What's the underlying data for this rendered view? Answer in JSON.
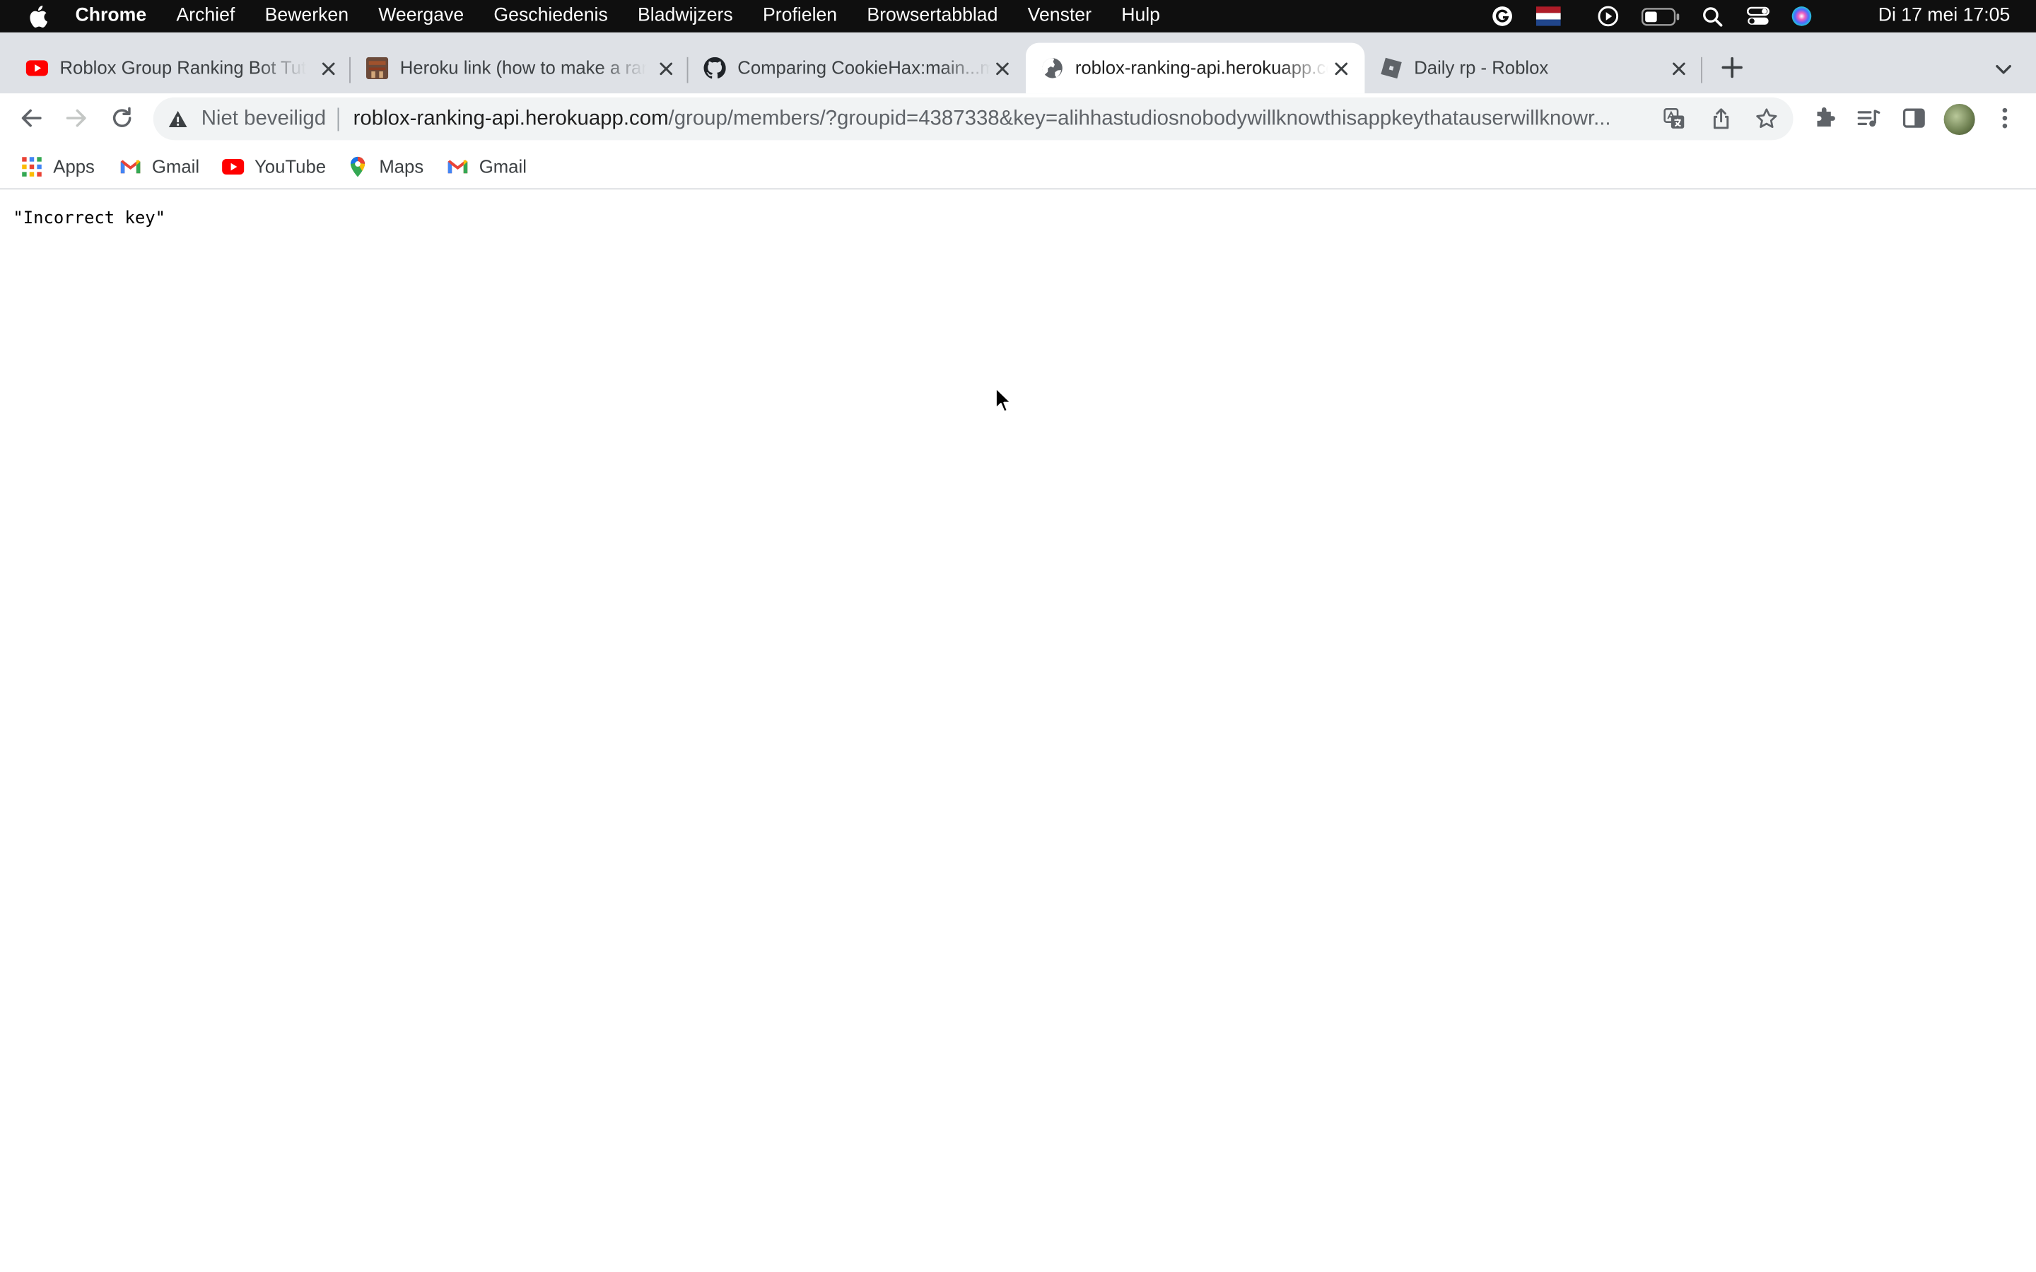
{
  "menubar": {
    "app_name": "Chrome",
    "items": [
      "Archief",
      "Bewerken",
      "Weergave",
      "Geschiedenis",
      "Bladwijzers",
      "Profielen",
      "Browsertabblad",
      "Venster",
      "Hulp"
    ],
    "clock": "Di 17 mei  17:05",
    "status_icons": [
      "grammarly-icon",
      "dutch-flag-icon",
      "play-circle-icon",
      "battery-icon",
      "spotlight-search-icon",
      "control-center-icon",
      "siri-icon"
    ]
  },
  "tabs": [
    {
      "title": "Roblox Group Ranking Bot Tutorial",
      "icon": "youtube-icon",
      "active": false
    },
    {
      "title": "Heroku link (how to make a ranking bot)",
      "icon": "image-thumbnail-icon",
      "active": false
    },
    {
      "title": "Comparing CookieHax:main...m",
      "icon": "github-icon",
      "active": false
    },
    {
      "title": "roblox-ranking-api.herokuapp.com",
      "icon": "globe-icon",
      "active": true
    },
    {
      "title": "Daily rp - Roblox",
      "icon": "roblox-icon",
      "active": false
    }
  ],
  "omnibox": {
    "security_label": "Niet beveiligd",
    "url_host": "roblox-ranking-api.herokuapp.com",
    "url_path": "/group/members/?groupid=4387338&key=alihhastudiosnobodywillknowthisappkeythatauserwillknowr..."
  },
  "bookmarks": [
    {
      "label": "Apps",
      "icon": "apps-grid-icon"
    },
    {
      "label": "Gmail",
      "icon": "gmail-icon"
    },
    {
      "label": "YouTube",
      "icon": "youtube-icon"
    },
    {
      "label": "Maps",
      "icon": "maps-pin-icon"
    },
    {
      "label": "Gmail",
      "icon": "gmail-icon"
    }
  ],
  "page": {
    "body_text": "\"Incorrect key\""
  },
  "colors": {
    "menubar_bg": "#0f0f0f",
    "tabstrip_bg": "#dee1e6",
    "omnibox_bg": "#f1f3f4",
    "youtube_red": "#ff0000",
    "flag_red": "#ae1c28",
    "flag_blue": "#21468b"
  }
}
